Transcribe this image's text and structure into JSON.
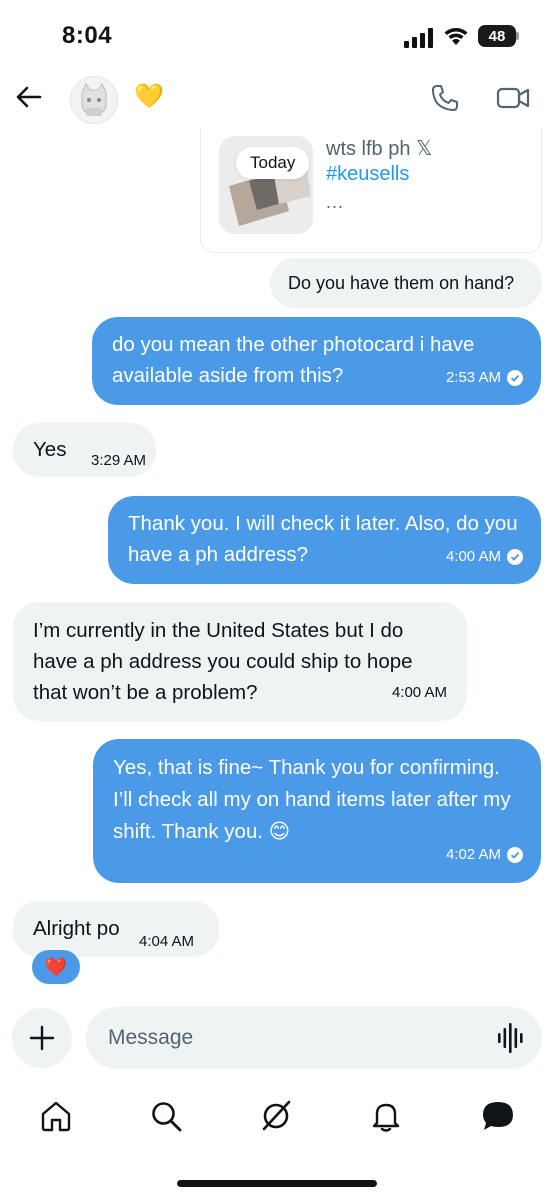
{
  "status_bar": {
    "time": "8:04",
    "battery": "48"
  },
  "header": {
    "avatar_icon": "cat-avatar-icon",
    "status_emoji": "💛"
  },
  "tweet_card": {
    "date_chip": "Today",
    "title": "wts lfb ph 𝕏",
    "hashtag": "#keusells",
    "more": "..."
  },
  "messages": [
    {
      "side": "recv",
      "text": "Do you have them on hand?",
      "time": ""
    },
    {
      "side": "sent",
      "text": "do you mean the other photocard i have available aside from this?",
      "time": "2:53 AM"
    },
    {
      "side": "recv",
      "text": "Yes",
      "time": "3:29 AM"
    },
    {
      "side": "sent",
      "text": "Thank you. I will check it later. Also, do you have a ph address?",
      "time": "4:00 AM"
    },
    {
      "side": "recv",
      "text": "I’m currently in the United States but I do have a ph address you could ship to hope that won’t be a problem?",
      "time": "4:00 AM"
    },
    {
      "side": "sent",
      "text": "Yes, that is fine~ Thank you for confirming. I’ll check all my on hand items later after my shift. Thank you. 😊",
      "time": "4:02 AM"
    },
    {
      "side": "recv",
      "text": "Alright po",
      "time": "4:04 AM"
    }
  ],
  "reaction": "❤️",
  "composer": {
    "placeholder": "Message"
  },
  "colors": {
    "accent": "#4a9ae8",
    "received_bubble": "#eff3f4",
    "link": "#1d9bf0"
  }
}
